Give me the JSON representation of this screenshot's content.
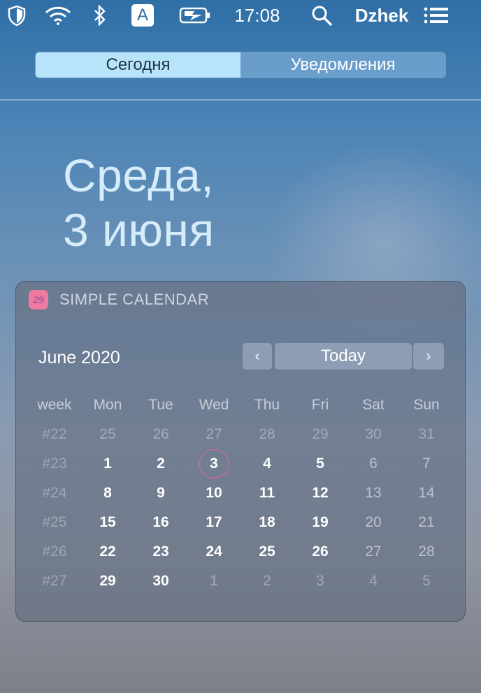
{
  "menubar": {
    "icons": [
      "shield-icon",
      "wifi-icon",
      "bluetooth-icon",
      "input-source-icon",
      "battery-charging-icon",
      "search-icon",
      "menu-list-icon"
    ],
    "input_source_letter": "A",
    "clock": "17:08",
    "user": "Dzhek"
  },
  "tabs": {
    "today": "Сегодня",
    "notifications": "Уведомления",
    "active": "today"
  },
  "date_heading": {
    "line1": "Среда,",
    "line2": "3 июня"
  },
  "widget": {
    "app_icon_text": "29",
    "title": "SIMPLE CALENDAR",
    "month": "June 2020",
    "prev_label": "‹",
    "today_label": "Today",
    "next_label": "›",
    "headers": [
      "week",
      "Mon",
      "Tue",
      "Wed",
      "Thu",
      "Fri",
      "Sat",
      "Sun"
    ],
    "weeks": [
      {
        "week": "#22",
        "days": [
          "25",
          "26",
          "27",
          "28",
          "29",
          "30",
          "31"
        ]
      },
      {
        "week": "#23",
        "days": [
          "1",
          "2",
          "3",
          "4",
          "5",
          "6",
          "7"
        ]
      },
      {
        "week": "#24",
        "days": [
          "8",
          "9",
          "10",
          "11",
          "12",
          "13",
          "14"
        ]
      },
      {
        "week": "#25",
        "days": [
          "15",
          "16",
          "17",
          "18",
          "19",
          "20",
          "21"
        ]
      },
      {
        "week": "#26",
        "days": [
          "22",
          "23",
          "24",
          "25",
          "26",
          "27",
          "28"
        ]
      },
      {
        "week": "#27",
        "days": [
          "29",
          "30",
          "1",
          "2",
          "3",
          "4",
          "5"
        ]
      }
    ],
    "today_highlight": "3",
    "colors": {
      "today_ring": "#e06a92",
      "app_icon": "#f07aa0"
    }
  }
}
